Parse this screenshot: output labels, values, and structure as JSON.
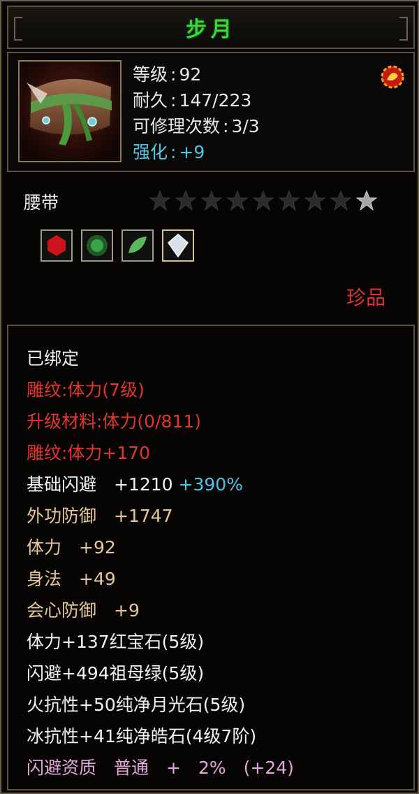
{
  "colors": {
    "title": "#3ed13c",
    "white": "#f2f2f2",
    "red": "#e2352e",
    "tan": "#e6c796",
    "cyan": "#4fc6e6",
    "pink": "#e3a7dc",
    "border": "#5c5140"
  },
  "item": {
    "name": "步月",
    "icon": "belt-item-icon",
    "badge_icon": "gem-badge-icon",
    "stats": {
      "level_label": "等级",
      "level_value": "92",
      "durability_label": "耐久",
      "durability_value": "147/223",
      "repair_label": "可修理次数",
      "repair_value": "3/3",
      "enhance_label": "强化",
      "enhance_value": "+9"
    },
    "type": "腰带",
    "stars_filled": 8,
    "stars_total": 9,
    "rarity": "珍品"
  },
  "gems": [
    {
      "name": "red-gem-icon",
      "color": "#c8141a"
    },
    {
      "name": "green-jade-ring-icon",
      "color": "#3aa24a"
    },
    {
      "name": "green-jade-leaf-icon",
      "color": "#5cb85c"
    },
    {
      "name": "diamond-gem-icon",
      "color": "#d8e0e8",
      "active": true
    }
  ],
  "attributes": [
    {
      "text": "已绑定",
      "color": "white"
    },
    {
      "text": "雕纹:体力(7级)",
      "color": "red"
    },
    {
      "text": "升级材料:体力(0/811)",
      "color": "red"
    },
    {
      "text": "雕纹:体力+170",
      "color": "red"
    },
    {
      "text": "基础闪避　+1210",
      "extra": "+390%",
      "color": "white"
    },
    {
      "text": "外功防御　+1747",
      "color": "tan"
    },
    {
      "text": "体力　+92",
      "color": "tan"
    },
    {
      "text": "身法　+49",
      "color": "tan"
    },
    {
      "text": "会心防御　+9",
      "color": "tan"
    },
    {
      "text": "体力+137红宝石(5级)",
      "color": "white"
    },
    {
      "text": "闪避+494祖母绿(5级)",
      "color": "white"
    },
    {
      "text": "火抗性+50纯净月光石(5级)",
      "color": "white"
    },
    {
      "text": "冰抗性+41纯净皓石(4级7阶)",
      "color": "white"
    },
    {
      "text": "闪避资质　普通　+　2%　(+24)",
      "color": "pink"
    }
  ]
}
